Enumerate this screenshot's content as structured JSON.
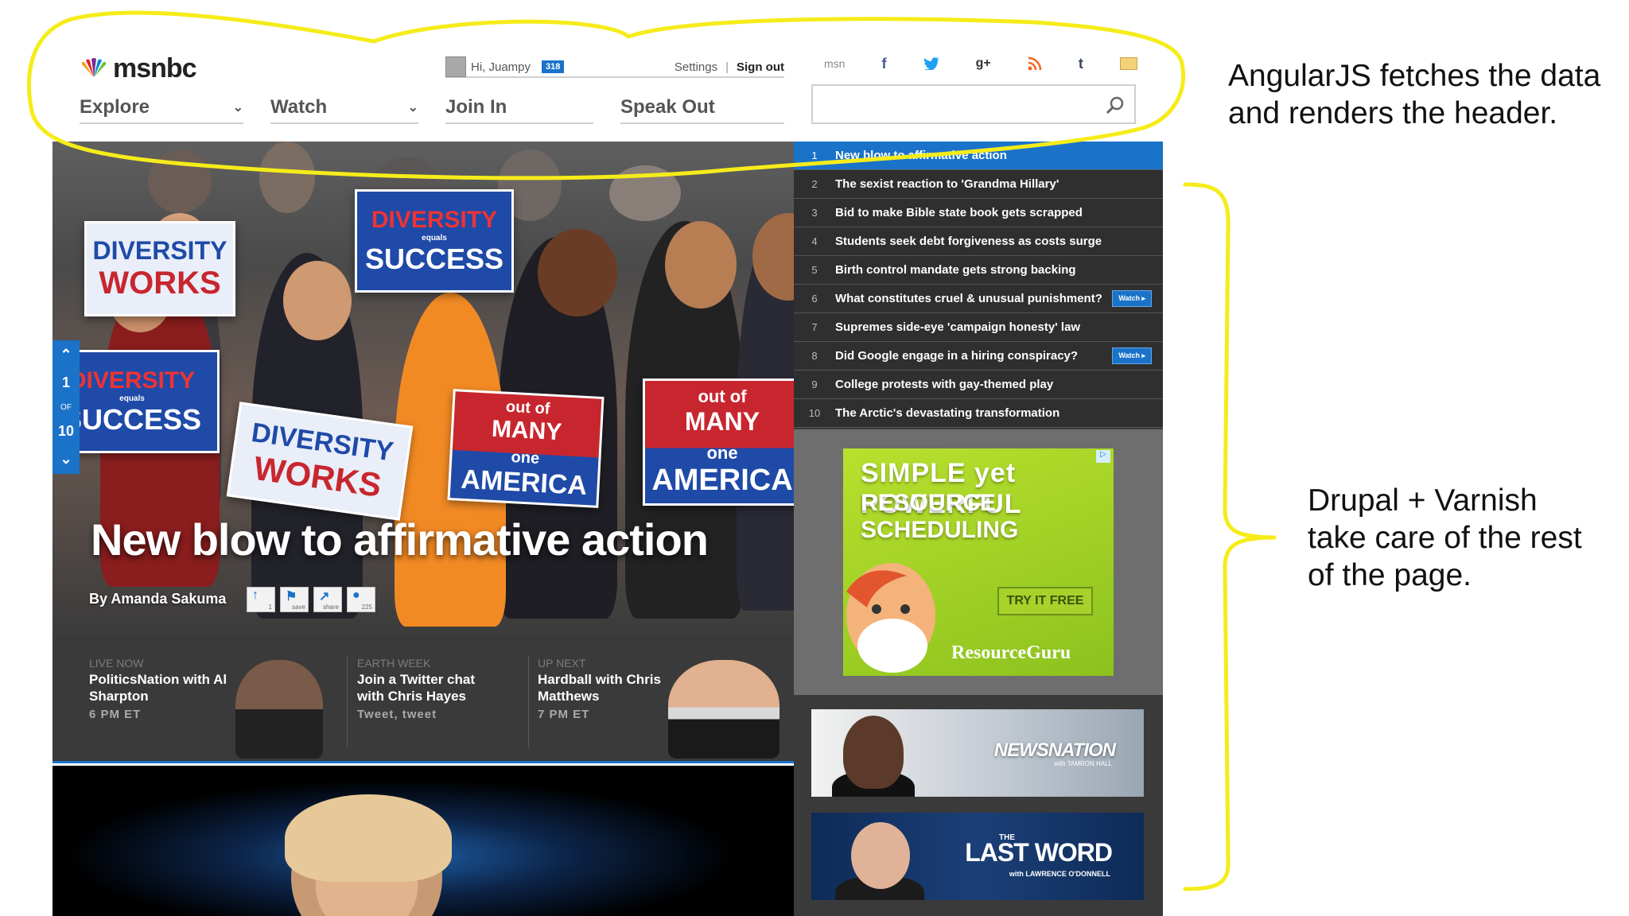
{
  "header": {
    "logo_text": "msnbc",
    "greeting": "Hi, Juampy",
    "badge": "318",
    "settings_label": "Settings",
    "separator": "|",
    "signout_label": "Sign out",
    "nav": [
      {
        "label": "Explore",
        "dropdown": true
      },
      {
        "label": "Watch",
        "dropdown": true
      },
      {
        "label": "Join In",
        "dropdown": false
      },
      {
        "label": "Speak Out",
        "dropdown": false
      }
    ],
    "search": {
      "value": "",
      "placeholder": ""
    },
    "social": {
      "msn_label": "msn",
      "facebook": "f",
      "gplus": "g+",
      "tumblr": "t"
    }
  },
  "hero": {
    "headline": "New blow to affirmative action",
    "byline": "By Amanda Sakuma",
    "slide_current": "1",
    "slide_of": "OF",
    "slide_total": "10",
    "tools": [
      {
        "icon": "arrow-up-icon",
        "count": "1"
      },
      {
        "icon": "bookmark-icon",
        "count": "save"
      },
      {
        "icon": "share-icon",
        "count": "share"
      },
      {
        "icon": "comment-icon",
        "count": "225"
      }
    ],
    "signs": {
      "diversity_top": "DIVERSITY",
      "equals": "equals",
      "success": "SUCCESS",
      "diversity_left": "DIVERSITY",
      "works_left": "WORKS",
      "diversity_center": "DIVERSITY",
      "works_center": "WORKS",
      "out_of": "out of",
      "many": "MANY",
      "one": "one",
      "america": "AMERICA"
    }
  },
  "shows": [
    {
      "kicker": "LIVE NOW",
      "title": "PoliticsNation with Al Sharpton",
      "meta": "6 PM ET"
    },
    {
      "kicker": "EARTH WEEK",
      "title": "Join a Twitter chat with Chris Hayes",
      "meta": "Tweet, tweet"
    },
    {
      "kicker": "UP NEXT",
      "title": "Hardball with Chris Matthews",
      "meta": "7 PM ET"
    }
  ],
  "top10": [
    {
      "num": "1",
      "label": "New blow to affirmative action",
      "watch": ""
    },
    {
      "num": "2",
      "label": "The sexist reaction to 'Grandma Hillary'",
      "watch": ""
    },
    {
      "num": "3",
      "label": "Bid to make Bible state book gets scrapped",
      "watch": ""
    },
    {
      "num": "4",
      "label": "Students seek debt forgiveness as costs surge",
      "watch": ""
    },
    {
      "num": "5",
      "label": "Birth control mandate gets strong backing",
      "watch": ""
    },
    {
      "num": "6",
      "label": "What constitutes cruel & unusual punishment?",
      "watch": "Watch ▸"
    },
    {
      "num": "7",
      "label": "Supremes side-eye 'campaign honesty' law",
      "watch": ""
    },
    {
      "num": "8",
      "label": "Did Google engage in a hiring conspiracy?",
      "watch": "Watch ▸"
    },
    {
      "num": "9",
      "label": "College protests with gay-themed play",
      "watch": ""
    },
    {
      "num": "10",
      "label": "The Arctic's devastating transformation",
      "watch": ""
    }
  ],
  "ad": {
    "headline_1": "SIMPLE yet POWERFUL",
    "headline_2": "RESOURCE SCHEDULING",
    "cta": "TRY IT FREE",
    "brand": "ResourceGuru",
    "adchoice": "▷"
  },
  "promos": [
    {
      "logo": "NEWSNATION",
      "sub": "with TAMRON HALL"
    },
    {
      "pre": "THE",
      "logo": "LAST WORD",
      "sub": "with LAWRENCE O'DONNELL"
    }
  ],
  "annotations": {
    "header_note_line1": "AngularJS fetches the data",
    "header_note_line2": "and renders the header.",
    "rest_note_line1": "Drupal + Varnish",
    "rest_note_line2": "take care of the rest",
    "rest_note_line3": "of the page."
  },
  "colors": {
    "accent_blue": "#1a73c9",
    "highlighter_yellow": "#f5ec1a",
    "ad_green": "#a6d22a",
    "dark_panel": "#3a3a3a"
  }
}
